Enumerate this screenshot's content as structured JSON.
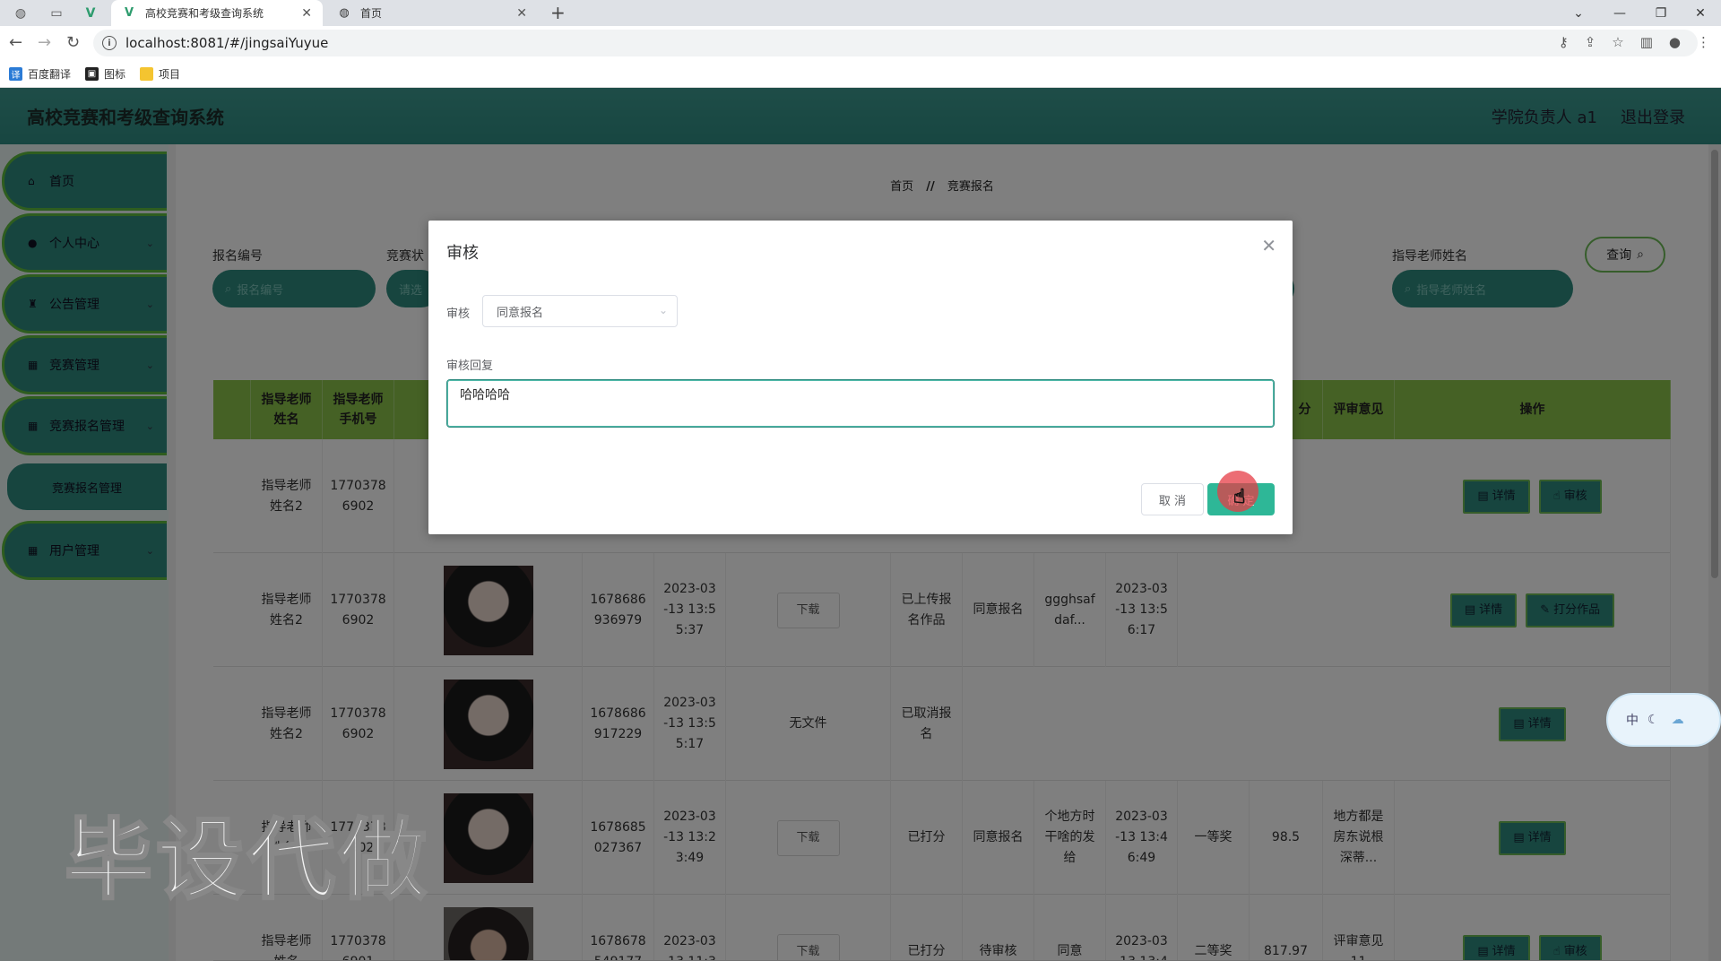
{
  "browser": {
    "tabs": [
      {
        "title": "高校竞赛和考级查询系统",
        "active": true
      },
      {
        "title": "首页",
        "active": false
      }
    ],
    "url": "localhost:8081/#/jingsaiYuyue",
    "bookmarks": [
      "百度翻译",
      "图标",
      "项目"
    ]
  },
  "app": {
    "title": "高校竞赛和考级查询系统",
    "user_label": "学院负责人 a1",
    "logout": "退出登录"
  },
  "sidebar": {
    "items": [
      {
        "label": "首页",
        "icon": "home-icon"
      },
      {
        "label": "个人中心",
        "icon": "user-icon"
      },
      {
        "label": "公告管理",
        "icon": "trophy-icon"
      },
      {
        "label": "竞赛管理",
        "icon": "grid-icon"
      },
      {
        "label": "竞赛报名管理",
        "icon": "grid-icon"
      },
      {
        "label": "用户管理",
        "icon": "grid-icon"
      }
    ],
    "submenu": "竞赛报名管理"
  },
  "breadcrumb": {
    "home": "首页",
    "sep": "//",
    "current": "竞赛报名"
  },
  "search": {
    "fields": [
      {
        "label": "报名编号",
        "placeholder": "报名编号"
      },
      {
        "label": "竞赛状",
        "placeholder": "请选"
      },
      {
        "label": "指导老师姓名",
        "placeholder": "指导老师姓名"
      }
    ],
    "button": "查询"
  },
  "table": {
    "headers": [
      "指导老师\n姓名",
      "指导老师\n手机号",
      "分",
      "评审意见",
      "操作"
    ],
    "rows": [
      {
        "teacher": "指导老师\n姓名2",
        "phone": "1770378\n6902",
        "code": "",
        "time": "",
        "file": "",
        "status": "",
        "review": "",
        "reply": "",
        "time2": "",
        "award": "",
        "score": "",
        "opinion": "",
        "ops": [
          "详情",
          "审核"
        ]
      },
      {
        "teacher": "指导老师\n姓名2",
        "phone": "1770378\n6902",
        "code": "1678686\n936979",
        "time": "2023-03\n-13 13:5\n5:37",
        "file": "下载",
        "status": "已上传报\n名作品",
        "review": "同意报名",
        "reply": "ggghsaf\ndaf...",
        "time2": "2023-03\n-13 13:5\n6:17",
        "award": "",
        "score": "",
        "opinion": "",
        "ops": [
          "详情",
          "打分作品"
        ]
      },
      {
        "teacher": "指导老师\n姓名2",
        "phone": "1770378\n6902",
        "code": "1678686\n917229",
        "time": "2023-03\n-13 13:5\n5:17",
        "file": "无文件",
        "status": "已取消报\n名",
        "review": "",
        "reply": "",
        "time2": "",
        "award": "",
        "score": "",
        "opinion": "",
        "ops": [
          "详情"
        ]
      },
      {
        "teacher": "指导老师\n姓名2",
        "phone": "1770378\n6902",
        "code": "1678685\n027367",
        "time": "2023-03\n-13 13:2\n3:49",
        "file": "下载",
        "status": "已打分",
        "review": "同意报名",
        "reply": "个地方时\n干啥的发\n给",
        "time2": "2023-03\n-13 13:4\n6:49",
        "award": "一等奖",
        "score": "98.5",
        "opinion": "地方都是\n房东说根\n深蒂...",
        "ops": [
          "详情"
        ]
      },
      {
        "teacher": "指导老师\n姓名",
        "phone": "1770378\n6901",
        "code": "1678678\n549177",
        "time": "2023-03\n-13 11:3",
        "file": "下载",
        "status": "已打分",
        "review": "待审核",
        "reply": "同意",
        "time2": "2023-03\n-13 13:4",
        "award": "二等奖",
        "score": "817.97",
        "opinion": "评审意见\n11",
        "ops": [
          "详情",
          "审核"
        ]
      }
    ]
  },
  "dialog": {
    "title": "审核",
    "field_label": "审核",
    "select_value": "同意报名",
    "reply_label": "审核回复",
    "reply_value": "哈哈哈哈",
    "cancel": "取 消",
    "confirm": "确 定"
  },
  "watermark": "毕设代做",
  "ime": "中"
}
